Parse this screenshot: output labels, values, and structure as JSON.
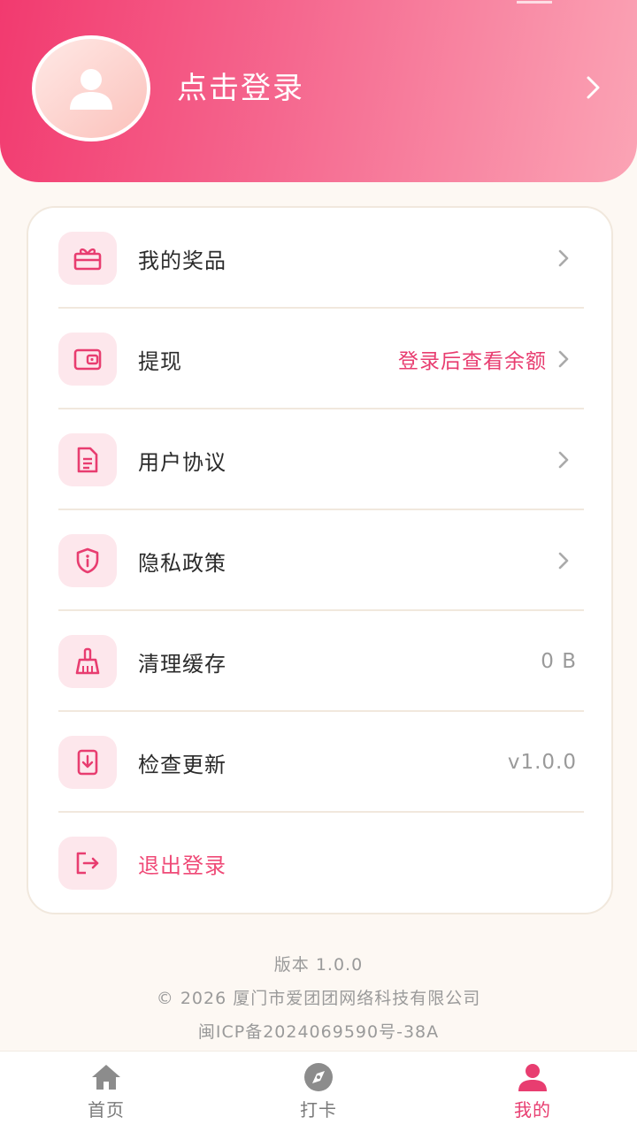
{
  "header": {
    "login_label": "点击登录"
  },
  "menu": {
    "items": [
      {
        "label": "我的奖品",
        "icon": "gift-icon",
        "right": ""
      },
      {
        "label": "提现",
        "icon": "wallet-icon",
        "right": "登录后查看余额"
      },
      {
        "label": "用户协议",
        "icon": "document-icon",
        "right": ""
      },
      {
        "label": "隐私政策",
        "icon": "shield-icon",
        "right": ""
      },
      {
        "label": "清理缓存",
        "icon": "broom-icon",
        "right": "0 B"
      },
      {
        "label": "检查更新",
        "icon": "update-icon",
        "right": "v1.0.0"
      },
      {
        "label": "退出登录",
        "icon": "logout-icon",
        "right": ""
      }
    ]
  },
  "footer": {
    "version": "版本 1.0.0",
    "copyright": "© 2026 厦门市爱团团网络科技有限公司",
    "icp": "闽ICP备2024069590号-38A"
  },
  "tabbar": {
    "tabs": [
      {
        "label": "首页",
        "icon": "home-icon",
        "active": false
      },
      {
        "label": "打卡",
        "icon": "compass-icon",
        "active": false
      },
      {
        "label": "我的",
        "icon": "user-icon",
        "active": true
      }
    ]
  },
  "colors": {
    "accent": "#e83d70",
    "header_start": "#f23a6f",
    "header_end": "#fba4b5",
    "icon_bg": "#fde7ec"
  }
}
